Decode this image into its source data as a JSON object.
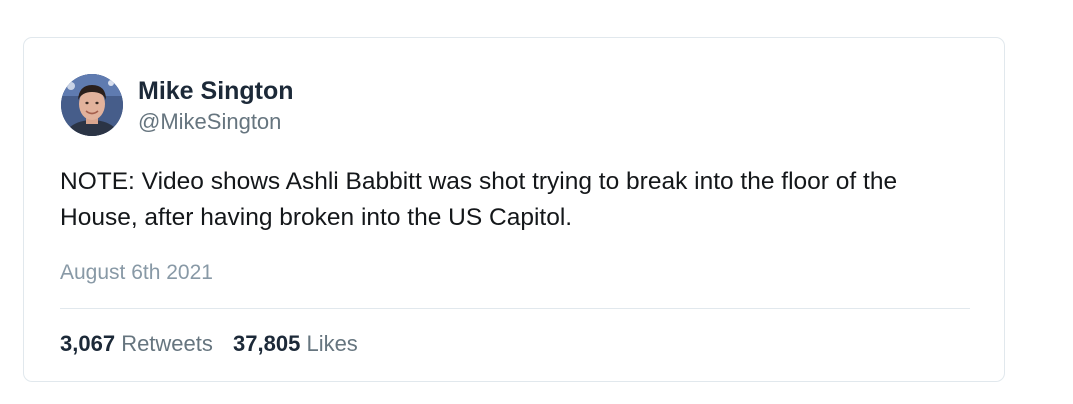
{
  "tweet": {
    "author": {
      "display_name": "Mike Sington",
      "handle": "@MikeSington",
      "avatar_icon": "user-avatar-photo"
    },
    "text": "NOTE: Video shows Ashli Babbitt was shot trying to break into the floor of the House, after having broken into the US Capitol.",
    "date": "August 6th 2021",
    "stats": {
      "retweets_count": "3,067",
      "retweets_label": "Retweets",
      "likes_count": "37,805",
      "likes_label": "Likes"
    }
  },
  "colors": {
    "name": "#1c2938",
    "secondary": "#66757f",
    "date": "#8899a6",
    "border": "#e1e8ed"
  }
}
